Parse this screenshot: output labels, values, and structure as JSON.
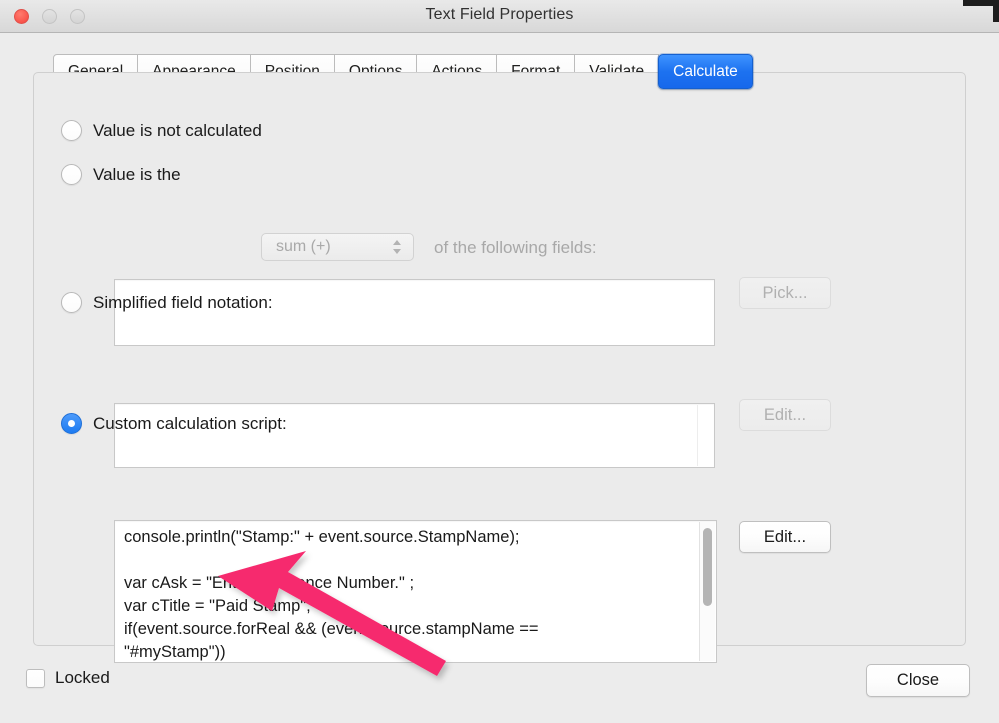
{
  "window": {
    "title": "Text Field Properties",
    "controls": {
      "close": "close-button",
      "minimize": "minimize-button",
      "maximize": "maximize-button"
    }
  },
  "tabs": [
    {
      "label": "General",
      "active": false
    },
    {
      "label": "Appearance",
      "active": false
    },
    {
      "label": "Position",
      "active": false
    },
    {
      "label": "Options",
      "active": false
    },
    {
      "label": "Actions",
      "active": false
    },
    {
      "label": "Format",
      "active": false
    },
    {
      "label": "Validate",
      "active": false
    },
    {
      "label": "Calculate",
      "active": true
    }
  ],
  "calculate": {
    "option_not_calculated": {
      "label": "Value is not calculated",
      "selected": false
    },
    "option_value_is_the": {
      "label": "Value is the",
      "selected": false,
      "operation_select": {
        "value": "sum (+)",
        "enabled": false
      },
      "suffix_label": "of the following fields:",
      "fields_value": "",
      "pick_button": {
        "label": "Pick...",
        "enabled": false
      }
    },
    "option_simplified": {
      "label": "Simplified field notation:",
      "selected": false,
      "value": "",
      "edit_button": {
        "label": "Edit...",
        "enabled": false
      }
    },
    "option_custom_script": {
      "label": "Custom calculation script:",
      "selected": true,
      "script": "console.println(\"Stamp:\" + event.source.StampName);\n\nvar cAsk = \"Enter Reference Number.\" ;\nvar cTitle = \"Paid Stamp\";\nif(event.source.forReal && (event.source.stampName ==\n\"#myStamp\"))\n{",
      "edit_button": {
        "label": "Edit...",
        "enabled": true
      }
    }
  },
  "footer": {
    "locked": {
      "label": "Locked",
      "checked": false
    },
    "close_button": {
      "label": "Close"
    }
  },
  "annotation": {
    "arrow_color": "#F62A6E",
    "description": "pink-arrow pointing to custom calculation script text"
  },
  "colors": {
    "accent_blue": "#1d72f0",
    "window_bg": "#ececec",
    "panel_bg": "#ebebeb",
    "arrow_pink": "#F62A6E"
  }
}
